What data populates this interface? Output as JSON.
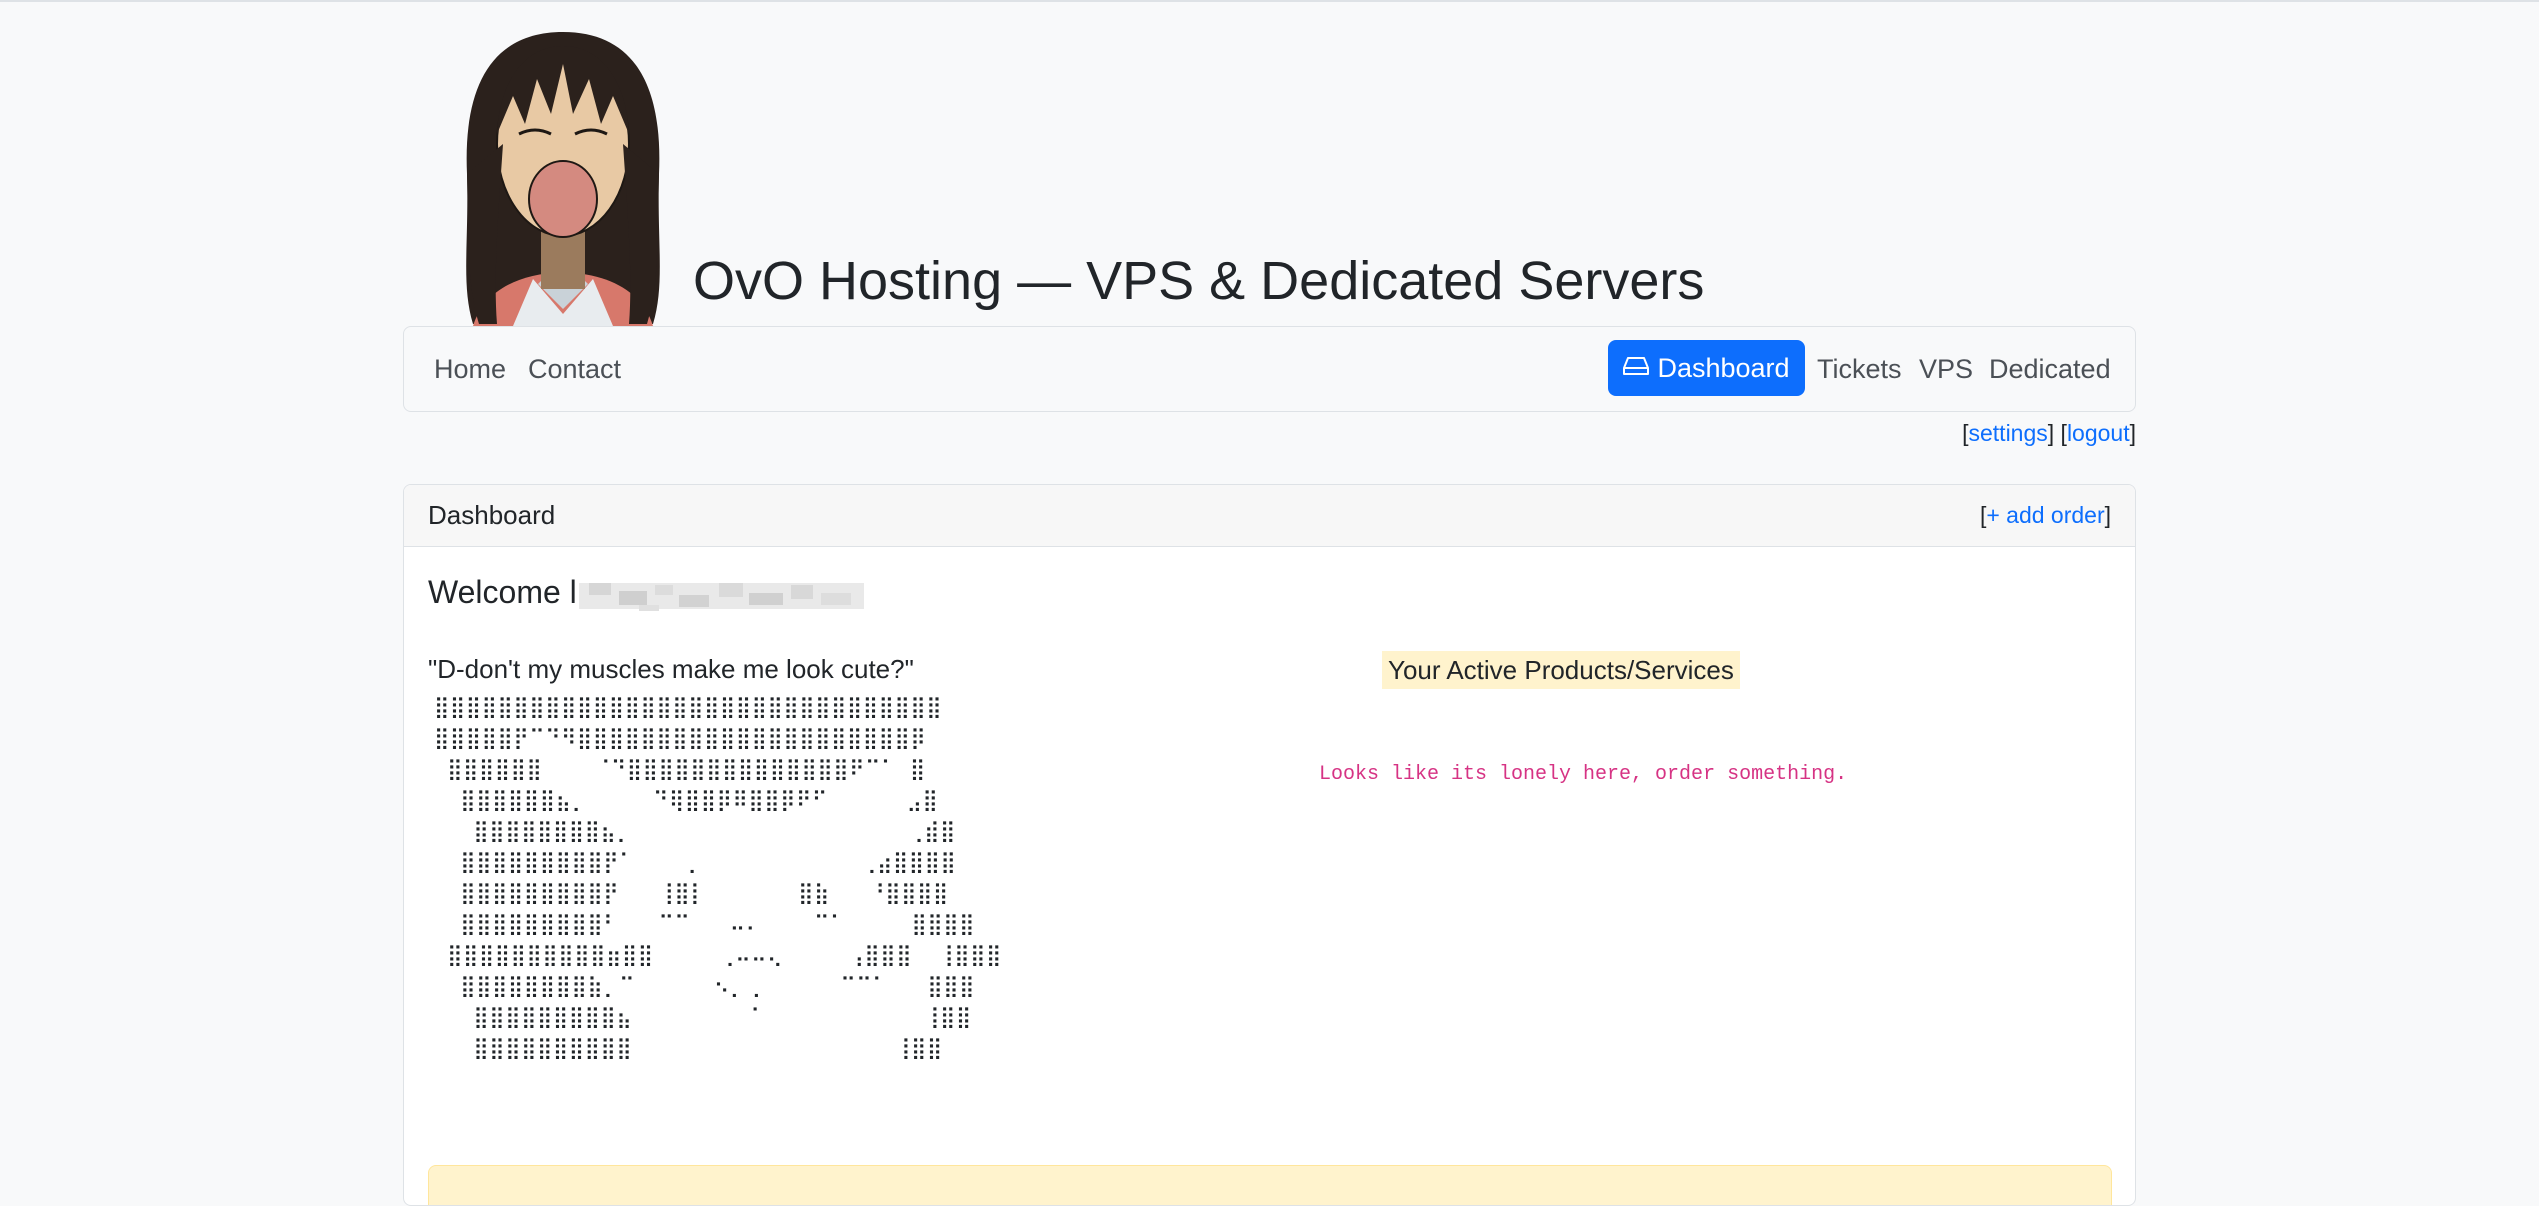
{
  "site": {
    "title": "OvO Hosting — VPS & Dedicated Servers"
  },
  "nav": {
    "left": [
      {
        "label": "Home"
      },
      {
        "label": "Contact"
      }
    ],
    "right": [
      {
        "label": "Dashboard",
        "icon": "server-icon",
        "active": true
      },
      {
        "label": "Tickets"
      },
      {
        "label": "VPS"
      },
      {
        "label": "Dedicated"
      }
    ]
  },
  "account": {
    "settings_label": "settings",
    "logout_label": "logout"
  },
  "dashboard": {
    "header_title": "Dashboard",
    "add_order_label": "+ add order",
    "welcome_text": "Welcome l",
    "quote": "\"D-don't my muscles make me look cute?\"",
    "ascii_art": "⣿⣿⣿⣿⣿⣿⣿⣿⣿⣿⣿⣿⣿⣿⣿⣿⣿⣿⣿⣿⣿⣿⣿⣿⣿⣿⣿⣿⣿⣿⣿⣿\n⣿⣿⣿⣿⣿⡟⠉⠙⠻⣿⣿⣿⣿⣿⣿⣿⣿⣿⣿⣿⣿⣿⣿⣿⣿⣿⣿⣿⣿⣿⡿\n ⣿⣿⣿⣿⣿⣿    ⠈⠙⣿⣿⣿⣿⣿⣿⣿⣿⣿⣿⣿⣿⣿⣿⠟⠉⠁ ⣿\n  ⣿⣿⣿⣿⣿⣿⣦⡀     ⠙⢿⣿⣿⡿⠿⣿⣿⡿⠟⠋      ⣠⣿\n   ⣿⣿⣿⣿⣿⣿⣿⣿⣦⡀                     ⢀⣾⣿\n  ⣿⣿⣿⣿⣿⣿⣿⣿⣿⡟⠁    ⡀            ⢀⣴⣿⣿⣿⣿\n  ⣿⣿⣿⣿⣿⣿⣿⣿⣿⡟   ⢸⣿⡇       ⣿⣷   ⠘⣿⣿⣿⣿\n  ⣿⣿⣿⣿⣿⣿⣿⣿⣿⠃   ⠉⠉   ⠤⠄    ⠉⠁     ⣿⣿⣿⣿\n ⣿⣿⣿⣿⣿⣿⣿⣿⣿⣿⣶⣿⣿     ⢀⠤⠤⢄     ⢠⣿⣿⣿  ⢸⣿⣿⣿\n  ⣿⣿⣿⣿⣿⣿⣿⣿⣷⡀⠉      ⠢⡀⢀      ⠉⠉⠁   ⣿⣿⣿\n   ⣿⣿⣿⣿⣿⣿⣿⣿⣿⣦         ⠁            ⢸⣿⣿\n   ⣿⣿⣿⣿⣿⣿⣿⣿⣿⣿                    ⢸⣿⣿",
    "products_title": "Your Active Products/Services",
    "empty_message": "Looks like its lonely here, order something."
  },
  "colors": {
    "primary": "#0d6efd",
    "highlight": "#fff3cd",
    "code_pink": "#d63384"
  }
}
